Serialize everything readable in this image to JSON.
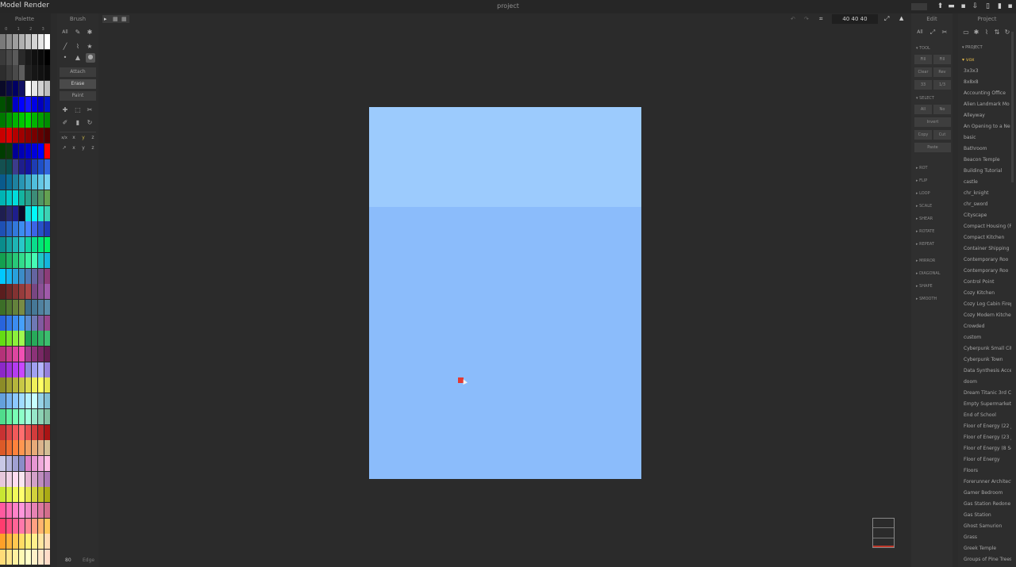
{
  "menu": {
    "model": "Model",
    "render": "Render"
  },
  "title": "project",
  "zoom_values": "40  40  40",
  "panels": {
    "palette": "Palette",
    "brush": "Brush",
    "edit": "Edit",
    "project": "Project"
  },
  "palette_indices": [
    "0",
    "1",
    "2",
    "3"
  ],
  "palette_rows": [
    [
      "#7a7a7a",
      "#8c8c8c",
      "#9e9e9e",
      "#b0b0b0",
      "#c2c2c2",
      "#d4d4d4",
      "#e6e6e6",
      "#ffffff"
    ],
    [
      "#3a3a3a",
      "#4a4a4a",
      "#5a5a5a",
      "#2a2a2a",
      "#1a1a1a",
      "#101010",
      "#0a0a0a",
      "#000000"
    ],
    [
      "#2d2d2d",
      "#3b3b3b",
      "#4a4a4a",
      "#5d5d5d",
      "#202020",
      "#161616",
      "#111111",
      "#0c0c0c"
    ],
    [
      "#0a0a28",
      "#0a0a46",
      "#000064",
      "#101064",
      "#ffffff",
      "#e6e6e6",
      "#d2d2d2",
      "#bebebe"
    ],
    [
      "#005000",
      "#003c00",
      "#0000c8",
      "#0000ff",
      "#1414ff",
      "#0000e6",
      "#0000be",
      "#0014c8"
    ],
    [
      "#007800",
      "#009600",
      "#00b400",
      "#00c800",
      "#00dc00",
      "#00b400",
      "#00a000",
      "#008c00"
    ],
    [
      "#c80000",
      "#dc0000",
      "#b40000",
      "#a00000",
      "#8c0000",
      "#780000",
      "#640000",
      "#500000"
    ],
    [
      "#003c00",
      "#0a3c0a",
      "#000096",
      "#0000b4",
      "#0000c8",
      "#0000dc",
      "#0000ff",
      "#ff0000"
    ],
    [
      "#145050",
      "#0a5050",
      "#3c3c8c",
      "#1e1e8c",
      "#1414a0",
      "#1e3cb4",
      "#1e50c8",
      "#3264dc"
    ],
    [
      "#0a5a8c",
      "#0a6e96",
      "#1e82a0",
      "#2896b4",
      "#3caac8",
      "#50bedc",
      "#64c8e6",
      "#78d2f0"
    ],
    [
      "#00b4b4",
      "#00c8c8",
      "#00dcdc",
      "#14b4a0",
      "#28a08c",
      "#3c8c78",
      "#509664",
      "#64a050"
    ],
    [
      "#1e1e50",
      "#28286e",
      "#1e1e8c",
      "#0a0a28",
      "#14dcdc",
      "#00fafa",
      "#28e6c8",
      "#3cd2b4"
    ],
    [
      "#1e50b4",
      "#2864c8",
      "#3278dc",
      "#3c8cf0",
      "#4682ff",
      "#3c64e6",
      "#2850c8",
      "#1e3cb4"
    ],
    [
      "#0a8c8c",
      "#14a0a0",
      "#1eb4b4",
      "#28c8c8",
      "#14d2a0",
      "#0adc8c",
      "#00e678",
      "#00f064"
    ],
    [
      "#14a050",
      "#1eb464",
      "#28c878",
      "#32dc8c",
      "#3cf0a0",
      "#46fab4",
      "#1ec8c8",
      "#14b4dc"
    ],
    [
      "#00c8ff",
      "#14b4f0",
      "#28a0dc",
      "#3c8cc8",
      "#5078b4",
      "#6464a0",
      "#78508c",
      "#8c3c78"
    ],
    [
      "#5a1e1e",
      "#6e2828",
      "#823232",
      "#963c3c",
      "#aa4646",
      "#784682",
      "#8c5096",
      "#a05aaa"
    ],
    [
      "#3c6e28",
      "#507832",
      "#64823c",
      "#788c46",
      "#3c6e8c",
      "#467896",
      "#5082a0",
      "#5a8caa"
    ],
    [
      "#2864dc",
      "#3278e6",
      "#3c8cf0",
      "#46a0fa",
      "#5a8cd2",
      "#6e78b4",
      "#825aa0",
      "#96468c"
    ],
    [
      "#64dc14",
      "#78e628",
      "#8cf03c",
      "#a0fa50",
      "#1ea050",
      "#28aa5a",
      "#32b464",
      "#3cbe6e"
    ],
    [
      "#b43278",
      "#c83c8c",
      "#dc46a0",
      "#f050b4",
      "#a03c8c",
      "#8c3278",
      "#782864",
      "#641e50"
    ],
    [
      "#8c28c8",
      "#a032dc",
      "#b43cf0",
      "#c846ff",
      "#8c8cdc",
      "#a0a0f0",
      "#b4b4ff",
      "#9682dc"
    ],
    [
      "#8c8c28",
      "#a0a032",
      "#b4b43c",
      "#c8c846",
      "#dcdc50",
      "#f0f05a",
      "#ffff64",
      "#e6e650"
    ],
    [
      "#64a0dc",
      "#78b4f0",
      "#8cc8ff",
      "#a0dcff",
      "#b4f0ff",
      "#c8ffff",
      "#96d2e6",
      "#82bed2"
    ],
    [
      "#50dc8c",
      "#64f0a0",
      "#78ffb4",
      "#8cffc8",
      "#a0ffdc",
      "#96e6c8",
      "#8cd2b4",
      "#82bea0"
    ],
    [
      "#c83232",
      "#dc4646",
      "#f05a5a",
      "#ff6e6e",
      "#e65050",
      "#d23c3c",
      "#be2828",
      "#aa1414"
    ],
    [
      "#dc5a28",
      "#f06e32",
      "#ff823c",
      "#ff9650",
      "#f0a064",
      "#e6aa78",
      "#dcb48c",
      "#d2be96"
    ],
    [
      "#c8c8e6",
      "#b4b4dc",
      "#a0a0d2",
      "#8c8cc8",
      "#dc82c8",
      "#e696d2",
      "#f0aadc",
      "#ffbee6"
    ],
    [
      "#e6c8dc",
      "#f0d2e6",
      "#ffdcf0",
      "#fae6f0",
      "#e6b4d2",
      "#d2a0c8",
      "#be8cbe",
      "#aa78b4"
    ],
    [
      "#c8e632",
      "#dcf046",
      "#f0fa5a",
      "#ffff6e",
      "#e6e650",
      "#d2d23c",
      "#bebe28",
      "#aaaa14"
    ],
    [
      "#ff5aa0",
      "#ff6eb4",
      "#ff82c8",
      "#ff96dc",
      "#f08cc8",
      "#e682b4",
      "#dc78a0",
      "#d26e8c"
    ],
    [
      "#ff3c6e",
      "#ff5082",
      "#ff6496",
      "#ff78aa",
      "#ff8c96",
      "#ffa082",
      "#ffb46e",
      "#ffc85a"
    ],
    [
      "#ffa028",
      "#ffb43c",
      "#ffc850",
      "#ffdc64",
      "#fff078",
      "#fff08c",
      "#ffe6a0",
      "#ffdcb4"
    ],
    [
      "#ffdc78",
      "#ffe68c",
      "#fff0a0",
      "#fffab4",
      "#ffffc8",
      "#fff0c8",
      "#ffe6c8",
      "#ffdcc8"
    ]
  ],
  "brush": {
    "all_label": "All",
    "attach": "Attach",
    "erase": "Erase",
    "paint": "Paint"
  },
  "edit": {
    "all_label": "All",
    "tool_header": "TOOL",
    "fill": "Fill",
    "fill2": "Fill",
    "clear": "Clear",
    "rev": "Rev",
    "btn_a": "33",
    "btn_b": "1/3",
    "select_header": "SELECT",
    "sel_all": "All",
    "sel_no": "No",
    "invert": "Invert",
    "copy": "Copy",
    "cut": "Cut",
    "paste": "Paste",
    "sections": [
      "ROT",
      "FLIP",
      "LOOP",
      "SCALE",
      "SHEAR",
      "ROTATE",
      "REPEAT",
      "MIRROR",
      "DIAGONAL",
      "SHAPE",
      "SMOOTH"
    ]
  },
  "project": {
    "header": "PROJECT",
    "current": "vox",
    "items": [
      "3x3x3",
      "8x8x8",
      "Accounting Office",
      "Alien Landmark Mo",
      "Alleyway",
      "An Opening to a Ne",
      "basic",
      "Bathroom",
      "Beacon Temple",
      "Building Tutorial",
      "castle",
      "chr_knight",
      "chr_sword",
      "Cityscape",
      "Compact Housing (F",
      "Compact Kitchen",
      "Container Shipping",
      "Contemporary Roo",
      "Contemporary Roo",
      "Control Point",
      "Cozy Kitchen",
      "Cozy Log Cabin Firep",
      "Cozy Modern Kitche",
      "Crowded",
      "custom",
      "Cyberpunk Small Cit",
      "Cyberpunk Town",
      "Data Synthesis Acce",
      "doom",
      "Dream Titanic 3rd Cl",
      "Empty Supermarket",
      "End of School",
      "Floor of Energy (22 J",
      "Floor of Energy (23 J",
      "Floor of Energy (8 Se",
      "Floor of Energy",
      "Floors",
      "Forerunner Architectu",
      "Gamer Bedroom",
      "Gas Station Redone",
      "Gas Station",
      "Ghost Samurion",
      "Grass",
      "Greek Temple",
      "Groups of Pine Trees"
    ]
  },
  "bottom": {
    "count": "80",
    "edge": "Edge"
  },
  "colors": {
    "sky_top": "#9ccbfd",
    "sky_body": "#8bbcfb",
    "marker": "#e23a34",
    "background": "#2b2b2b"
  }
}
